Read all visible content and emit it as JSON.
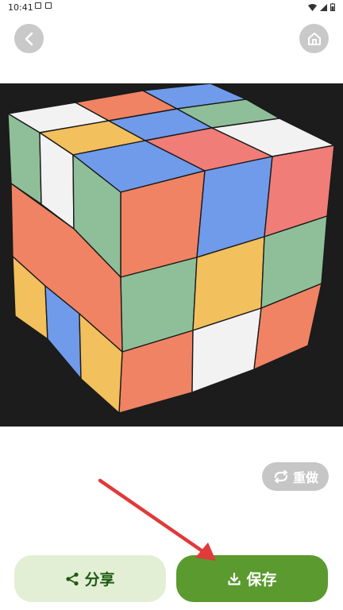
{
  "status_bar": {
    "time": "10:41"
  },
  "nav": {
    "back_icon": "chevron-left-icon",
    "home_icon": "home-icon"
  },
  "cube_image": {
    "subject": "rubiks-cube-4x4"
  },
  "actions": {
    "redo_label": "重做",
    "share_label": "分享",
    "save_label": "保存"
  },
  "colors": {
    "share_bg": "#e3efd5",
    "share_text": "#1f5b12",
    "save_bg": "#5a9a2e",
    "redo_bg": "#c6c6c6",
    "cube_bg": "#1c1c1c",
    "annotation_arrow": "#e03a3a"
  }
}
